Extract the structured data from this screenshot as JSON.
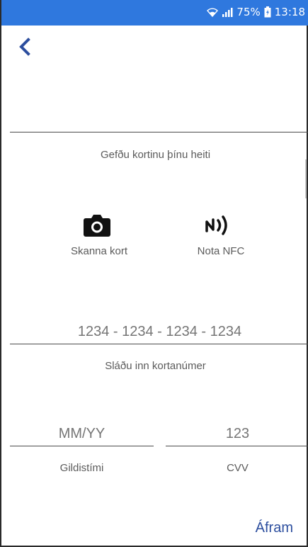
{
  "status_bar": {
    "battery": "75%",
    "time": "13:18",
    "bg_color": "#2f78de"
  },
  "nav": {
    "back_icon": "chevron-left-icon"
  },
  "form": {
    "name_prompt": "Gefðu kortinu þínu heiti",
    "scan_label": "Skanna kort",
    "scan_icon": "camera-icon",
    "nfc_label": "Nota NFC",
    "nfc_icon": "nfc-icon",
    "card_number_placeholder": "1234 - 1234 - 1234 - 1234",
    "card_number_label": "Sláðu inn kortanúmer",
    "expiry_placeholder": "MM/YY",
    "expiry_label": "Gildistími",
    "cvv_placeholder": "123",
    "cvv_label": "CVV"
  },
  "actions": {
    "next_label": "Áfram",
    "accent_color": "#2c4e9e"
  }
}
